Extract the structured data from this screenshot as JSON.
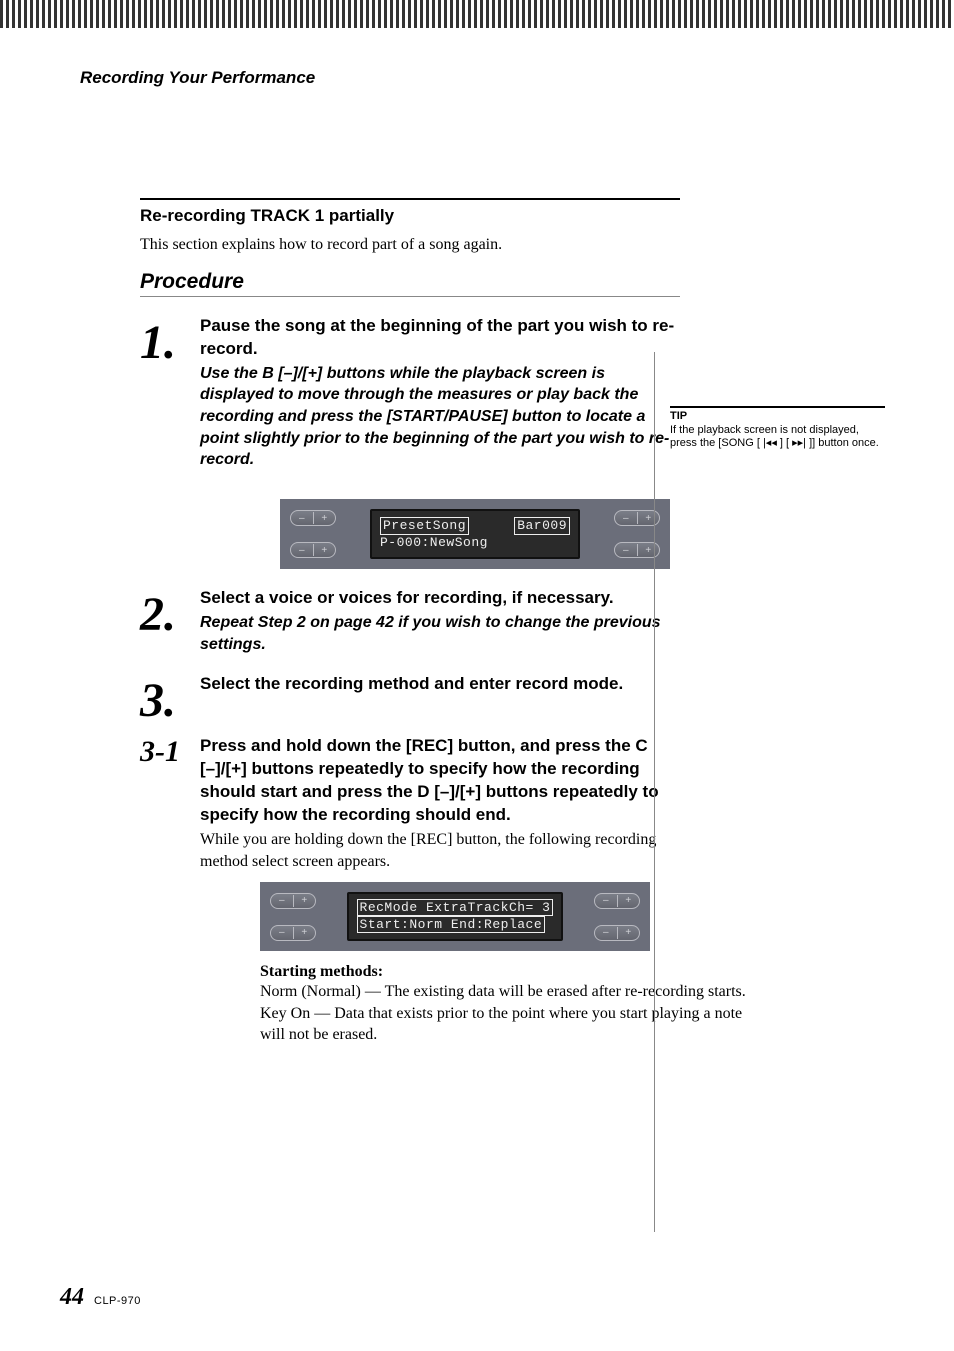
{
  "header": {
    "chapter": "Recording Your Performance"
  },
  "section": {
    "title": "Re-recording TRACK 1 partially",
    "intro": "This section explains how to record part of a song again.",
    "procedure_label": "Procedure"
  },
  "steps": {
    "s1": {
      "num": "1.",
      "head": "Pause the song at the beginning of the part you wish to re-record.",
      "instr": "Use the B [–]/[+] buttons while the playback screen is displayed to move through the measures or play back the recording and press the [START/PAUSE] button to locate a point slightly prior to the beginning of the part you wish to re-record."
    },
    "s2": {
      "num": "2.",
      "head": "Select a voice or voices for recording, if necessary.",
      "instr": "Repeat Step 2 on page 42 if you wish to change the previous settings."
    },
    "s3": {
      "num": "3.",
      "head": "Select the recording method and enter record mode."
    },
    "s3_1": {
      "num": "3-1",
      "head": "Press and hold down the [REC] button, and press the C [–]/[+] buttons repeatedly to specify how the recording should start and press the D [–]/[+] buttons repeatedly to specify how the recording should end.",
      "follow": "While you are holding down the [REC] button, the following recording method select screen appears."
    }
  },
  "lcd1": {
    "line1_left": "PresetSong",
    "line1_right": "Bar009",
    "line2": "P-000:NewSong"
  },
  "lcd2": {
    "line1": "RecMode  ExtraTrackCh= 3",
    "line2": "Start:Norm  End:Replace"
  },
  "starting": {
    "label": "Starting methods:",
    "norm": "Norm (Normal) — The existing data will be erased after re-recording starts.",
    "keyon": "Key On — Data that exists prior to the point where you start playing a note will not be erased."
  },
  "tip": {
    "label": "TIP",
    "body_pre": "If the playback screen is not displayed, press the [SONG ",
    "body_post": "] button once."
  },
  "footer": {
    "page": "44",
    "model": "CLP-970"
  },
  "glyphs": {
    "minus": "–",
    "plus": "+",
    "rew": "◂◂",
    "fwd": "▸▸",
    "bar_rew": "|◂◂",
    "bar_fwd": "▸▸|"
  }
}
